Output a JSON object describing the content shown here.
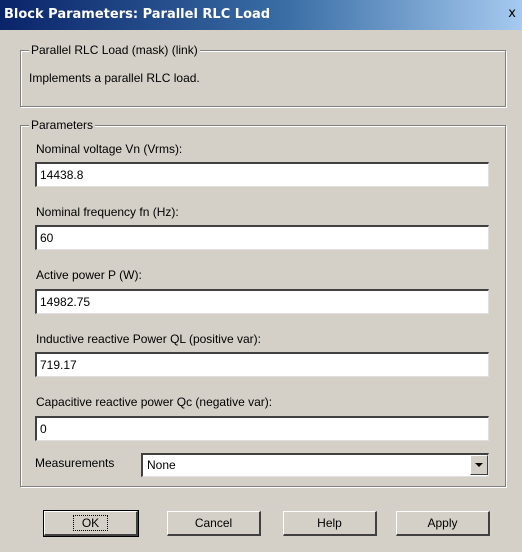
{
  "window": {
    "title": "Block Parameters: Parallel RLC Load",
    "close_symbol": "x"
  },
  "description": {
    "group_label": "Parallel RLC Load (mask) (link)",
    "text": "Implements a parallel RLC load."
  },
  "parameters": {
    "group_label": "Parameters",
    "fields": [
      {
        "label": "Nominal voltage Vn (Vrms):",
        "value": "14438.8"
      },
      {
        "label": "Nominal frequency fn (Hz):",
        "value": "60"
      },
      {
        "label": "Active power P (W):",
        "value": "14982.75"
      },
      {
        "label": "Inductive reactive Power QL (positive var):",
        "value": "719.17"
      },
      {
        "label": "Capacitive reactive power Qc (negative var):",
        "value": "0"
      }
    ],
    "measurements": {
      "label": "Measurements",
      "selected": "None"
    }
  },
  "buttons": {
    "ok": "OK",
    "cancel": "Cancel",
    "help": "Help",
    "apply": "Apply"
  }
}
